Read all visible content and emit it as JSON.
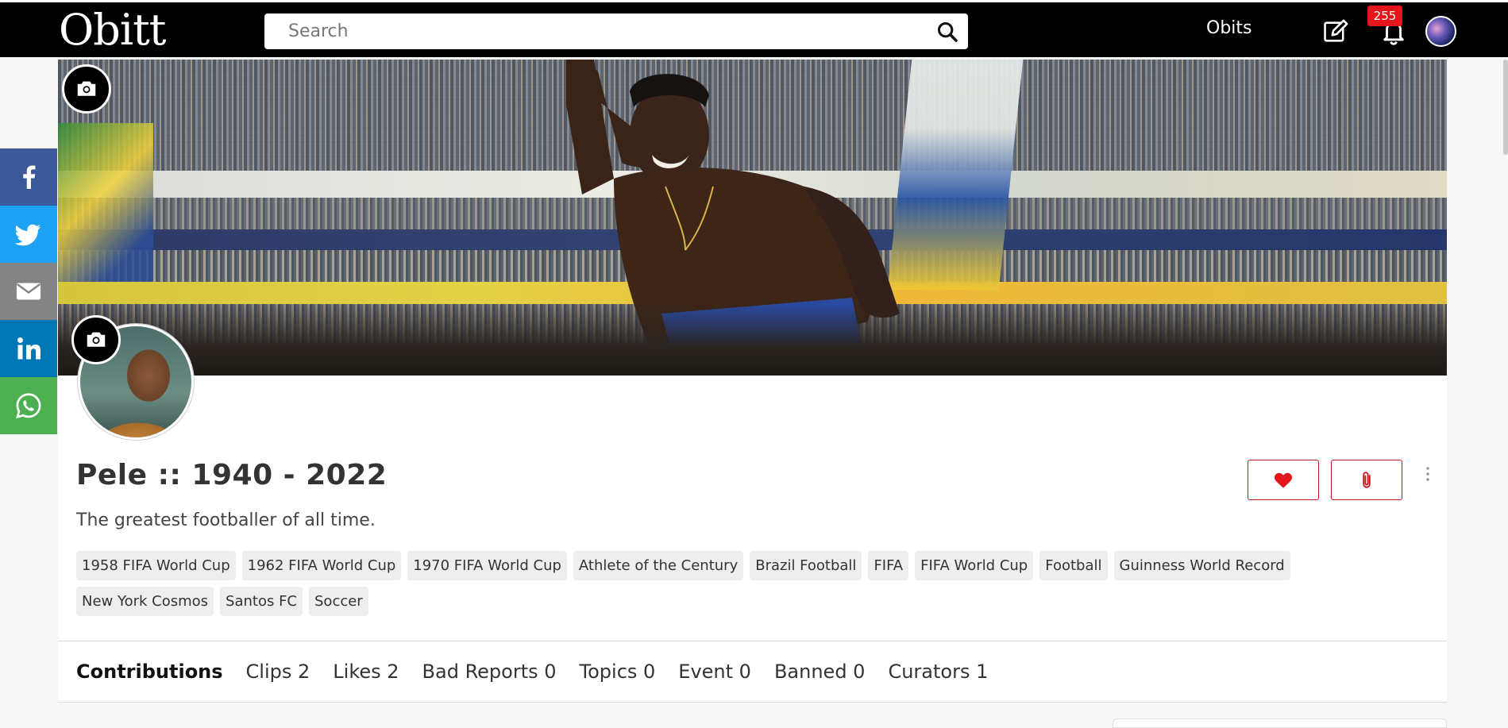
{
  "header": {
    "logo": "Obitt",
    "search_placeholder": "Search",
    "nav_link": "Obits",
    "notification_count": "255",
    "icons": [
      "search-icon",
      "edit-icon",
      "bell-icon",
      "user-avatar"
    ]
  },
  "social": {
    "items": [
      {
        "name": "facebook",
        "color": "#3b5998"
      },
      {
        "name": "twitter",
        "color": "#1da1f2"
      },
      {
        "name": "email",
        "color": "#848484"
      },
      {
        "name": "linkedin",
        "color": "#0077b5"
      },
      {
        "name": "whatsapp",
        "color": "#4caf50"
      }
    ]
  },
  "profile": {
    "title": "Pele :: 1940 - 2022",
    "tagline": "The greatest footballer of all time.",
    "tags": [
      "1958 FIFA World Cup",
      "1962 FIFA World Cup",
      "1970 FIFA World Cup",
      "Athlete of the Century",
      "Brazil Football",
      "FIFA",
      "FIFA World Cup",
      "Football",
      "Guinness World Record",
      "New York Cosmos",
      "Santos FC",
      "Soccer"
    ]
  },
  "tabs": [
    {
      "label": "Contributions",
      "active": true
    },
    {
      "label": "Clips 2",
      "active": false
    },
    {
      "label": "Likes 2",
      "active": false
    },
    {
      "label": "Bad Reports 0",
      "active": false
    },
    {
      "label": "Topics 0",
      "active": false
    },
    {
      "label": "Event 0",
      "active": false
    },
    {
      "label": "Banned 0",
      "active": false
    },
    {
      "label": "Curators 1",
      "active": false
    }
  ],
  "colors": {
    "accent": "#c4151c",
    "badge": "#e4161b",
    "topbar": "#000000"
  }
}
